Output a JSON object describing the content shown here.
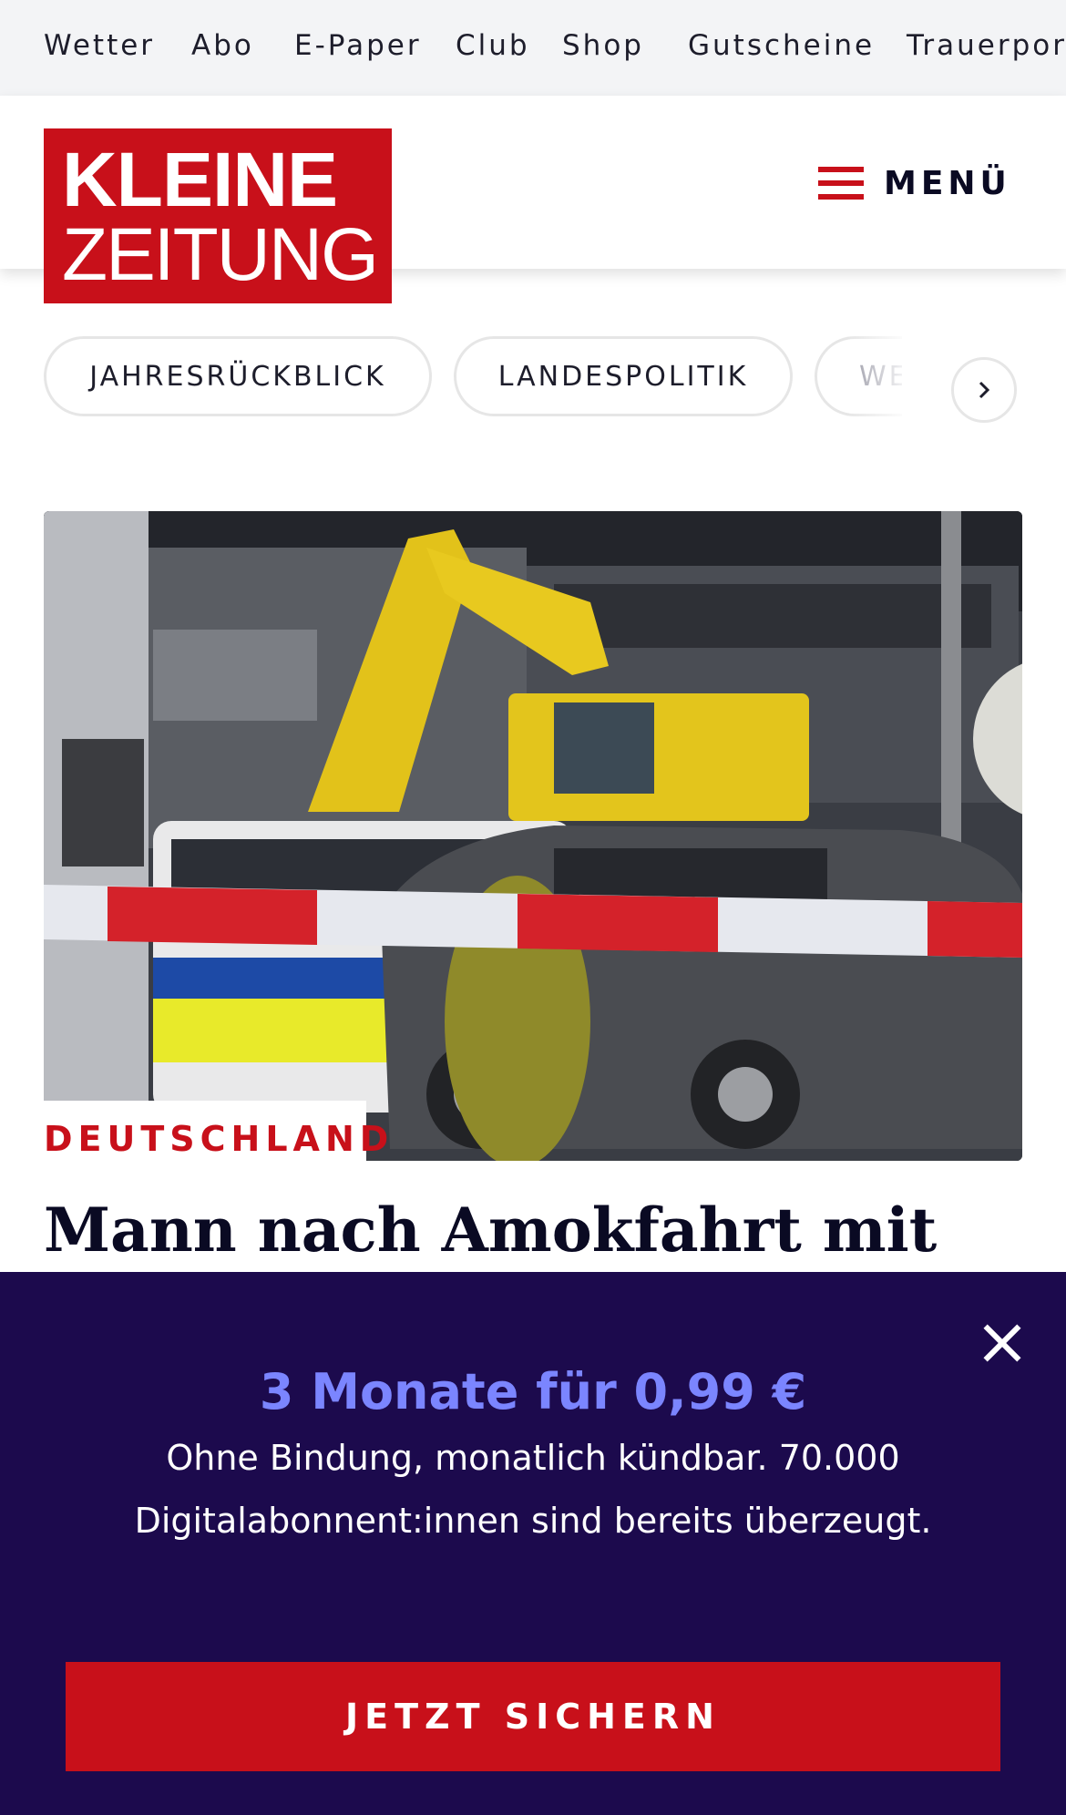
{
  "topnav": {
    "items": [
      "Wetter",
      "Abo",
      "E-Paper",
      "Club",
      "Shop",
      "Gutscheine",
      "Trauerportal"
    ]
  },
  "header": {
    "logo_line1": "KLEINE",
    "logo_line2": "ZEITUNG",
    "menu_label": "MENÜ",
    "menu_icon": "hamburger-icon"
  },
  "tags": {
    "items": [
      "JAHRESRÜCKBLICK",
      "LANDESPOLITIK",
      "WE"
    ],
    "next_icon": "chevron-right-icon"
  },
  "teaser": {
    "kicker": "DEUTSCHLAND",
    "headline": "Mann nach Amokfahrt mit"
  },
  "paywall": {
    "offer": "3 Monate für 0,99 €",
    "subtitle": "Ohne Bindung, monatlich kündbar. 70.000 Digitalabonnent:innen sind bereits überzeugt.",
    "cta_label": "JETZT SICHERN",
    "close_icon": "close-icon"
  },
  "colors": {
    "brand_red": "#c8101a",
    "paywall_bg": "#1c0a4d",
    "offer_text": "#7b85ff"
  }
}
